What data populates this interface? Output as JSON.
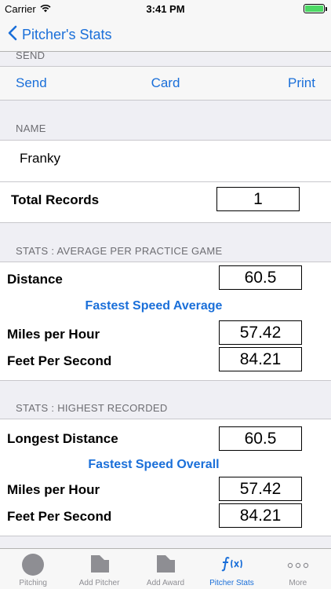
{
  "status_bar": {
    "carrier": "Carrier",
    "time": "3:41 PM"
  },
  "nav": {
    "back_label": "Pitcher's Stats"
  },
  "send_section": {
    "header": "SEND",
    "actions": {
      "send": "Send",
      "card": "Card",
      "print": "Print"
    }
  },
  "name_section": {
    "header": "NAME",
    "name_value": "Franky",
    "total_records_label": "Total Records",
    "total_records_value": "1"
  },
  "average_section": {
    "header": "STATS : AVERAGE PER PRACTICE GAME",
    "distance_label": "Distance",
    "distance_value": "60.5",
    "subheading": "Fastest Speed Average",
    "mph_label": "Miles per Hour",
    "mph_value": "57.42",
    "fps_label": "Feet Per Second",
    "fps_value": "84.21"
  },
  "highest_section": {
    "header": "STATS : HIGHEST RECORDED",
    "distance_label": "Longest Distance",
    "distance_value": "60.5",
    "subheading": "Fastest Speed Overall",
    "mph_label": "Miles per Hour",
    "mph_value": "57.42",
    "fps_label": "Feet Per Second",
    "fps_value": "84.21"
  },
  "tab_bar": {
    "tabs": [
      {
        "label": "Pitching",
        "icon": "baseball-icon"
      },
      {
        "label": "Add Pitcher",
        "icon": "add-pitcher-icon"
      },
      {
        "label": "Add Award",
        "icon": "add-award-icon"
      },
      {
        "label": "Pitcher Stats",
        "icon": "function-icon"
      },
      {
        "label": "More",
        "icon": "more-icon"
      }
    ]
  },
  "colors": {
    "accent": "#1a6fd9",
    "background": "#efeff4",
    "battery": "#4cd964"
  }
}
